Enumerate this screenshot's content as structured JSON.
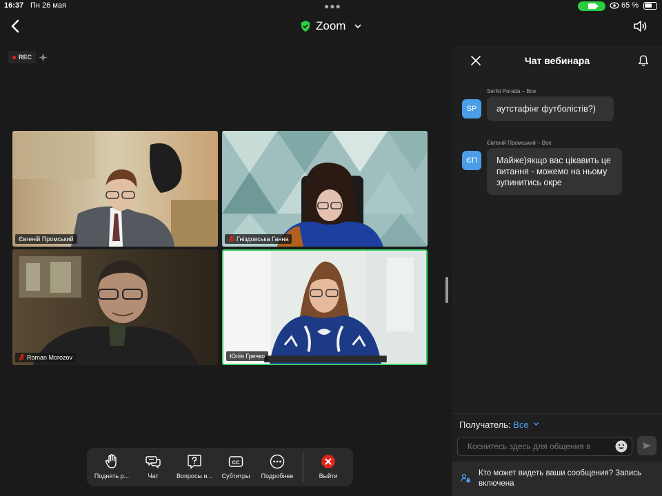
{
  "status_bar": {
    "time": "16:37",
    "date": "Пн 26 мая",
    "battery_text": "65 %",
    "battery_level": 0.65
  },
  "header": {
    "title": "Zoom",
    "secure_color": "#2ecc40"
  },
  "recording": {
    "label": "REC"
  },
  "participants": [
    {
      "name": "Євгеній Промський",
      "muted": false,
      "active": false
    },
    {
      "name": "Гніздовська Ганна",
      "muted": true,
      "active": false
    },
    {
      "name": "Roman Morozov",
      "muted": true,
      "active": false
    },
    {
      "name": "Юлія Гречко",
      "muted": false,
      "active": true
    }
  ],
  "controls": {
    "raise_hand": "Поднять р...",
    "chat": "Чат",
    "questions": "Вопросы и...",
    "subtitles": "Субтитры",
    "more": "Подробнее",
    "leave": "Выйти"
  },
  "chat": {
    "title": "Чат вебинара",
    "messages": [
      {
        "meta": "Serhii Porada – Все",
        "initials": "SP",
        "text": "аутстафінг футболістів?)"
      },
      {
        "meta": "Євгеній Промський – Все",
        "initials": "ЄП",
        "text": "Майже)якщо вас цікавить це питання - можемо на ньому зупинитись окре"
      }
    ],
    "recipient_label": "Получатель:",
    "recipient_value": "Все",
    "input_placeholder": "Коснитесь здесь для общения в чате",
    "notice": "Кто может видеть ваши сообщения? Запись включена"
  },
  "colors": {
    "accent_blue": "#4aa4ff",
    "active_speaker": "#3dd068",
    "avatar": "#4a9de6",
    "leave_red": "#e0261c"
  }
}
